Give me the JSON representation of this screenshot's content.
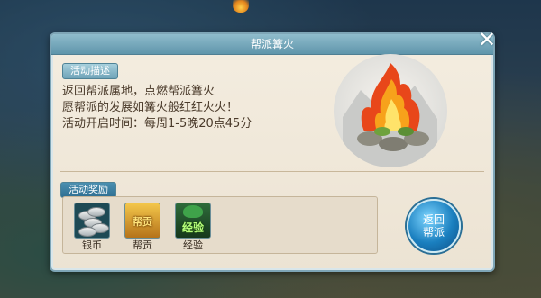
{
  "dialog": {
    "title": "帮派篝火",
    "close_symbol": "✕",
    "description_tag": "活动描述",
    "description_lines": [
      "返回帮派属地，点燃帮派篝火",
      "愿帮派的发展如篝火般红红火火！",
      "活动开启时间：每周1-5晚20点45分"
    ],
    "reward_tag": "活动奖励",
    "rewards": [
      {
        "label": "银币",
        "icon": "silver-coins-icon"
      },
      {
        "label": "帮贡",
        "icon": "guild-contribution-icon",
        "icon_text": "帮贡"
      },
      {
        "label": "经验",
        "icon": "experience-icon",
        "icon_text": "经验"
      }
    ],
    "return_button_line1": "返回",
    "return_button_line2": "帮派"
  },
  "colors": {
    "titlebar": "#6fa3b8",
    "panel": "#f4ede0",
    "text": "#4a3a2a",
    "button": "#1a7fbf"
  }
}
